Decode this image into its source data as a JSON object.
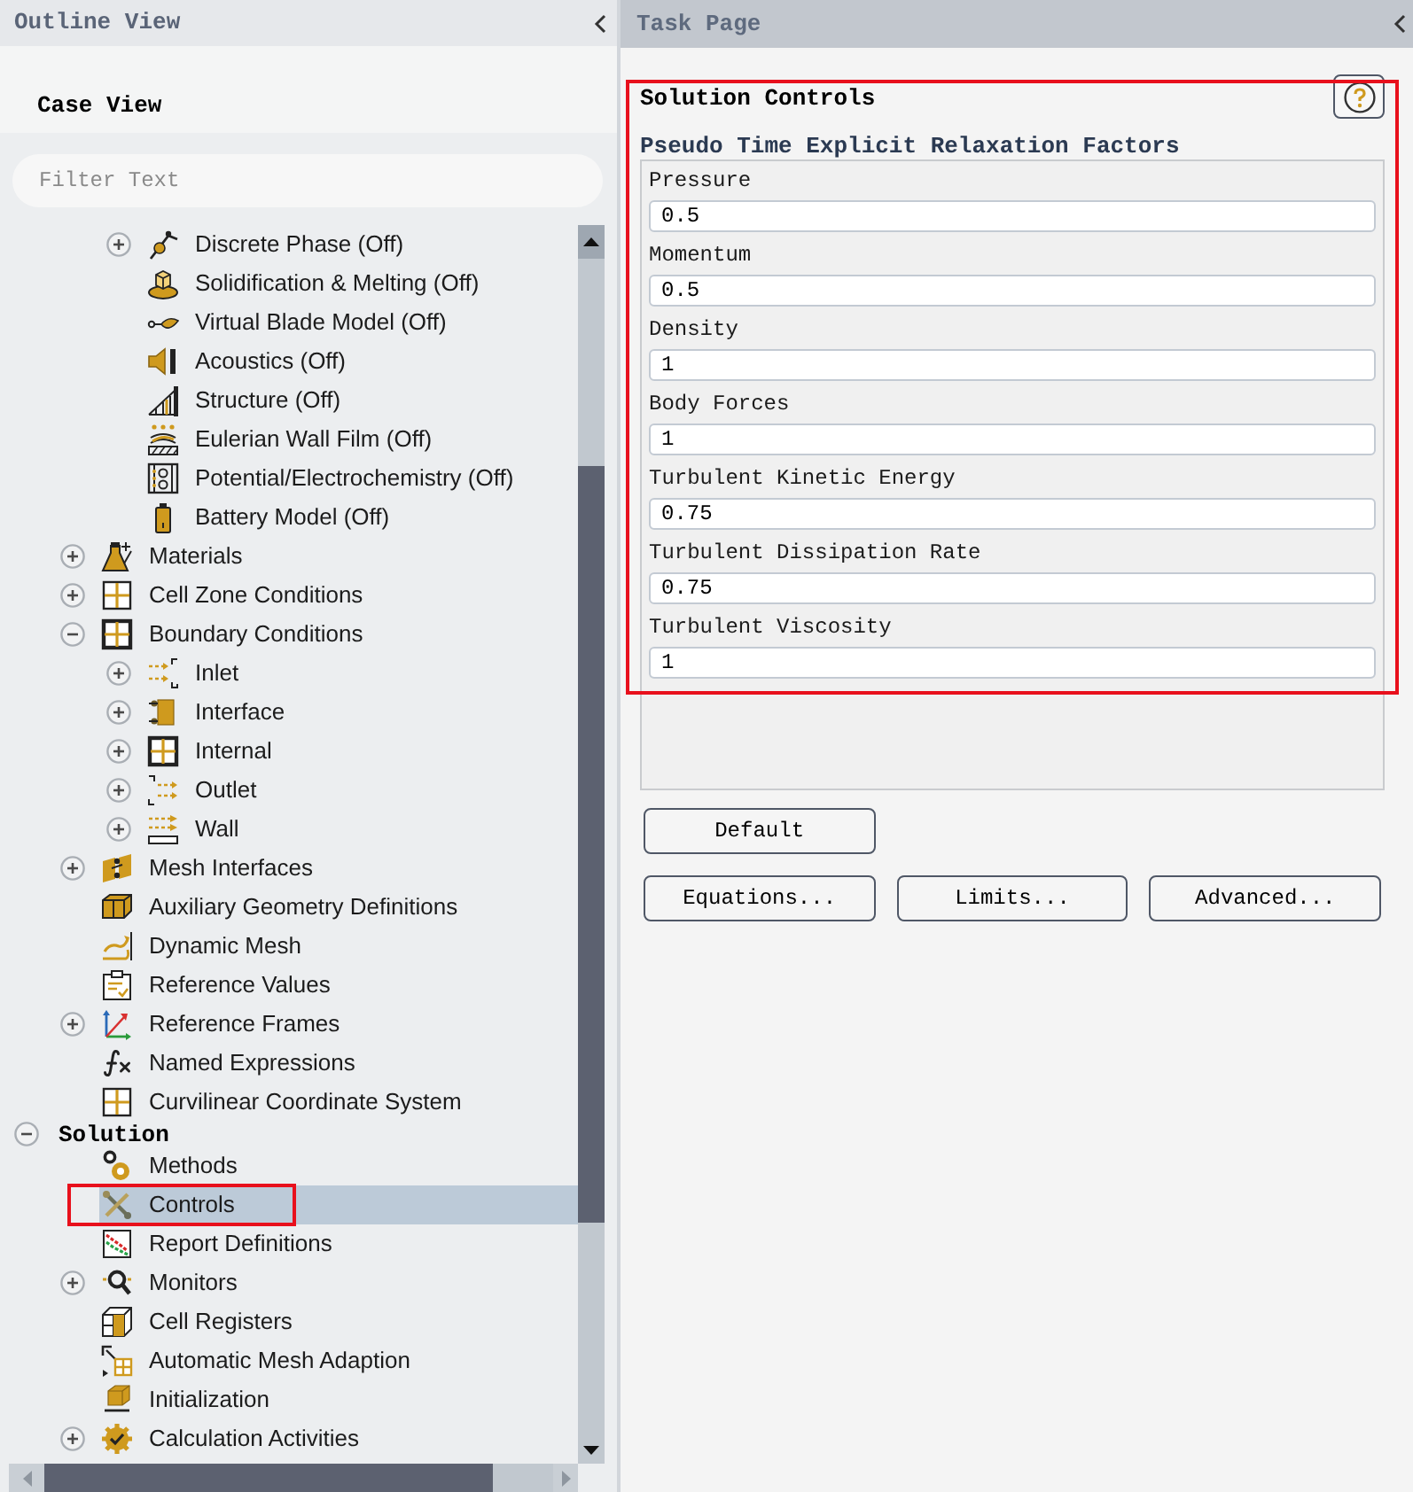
{
  "outline_view": {
    "title": "Outline View",
    "tab": "Case View",
    "filter": {
      "placeholder": "Filter Text"
    },
    "tree": [
      {
        "children": [
          {
            "children": [
              {
                "label": "Discrete Phase (Off)",
                "expanded": false,
                "selected": false,
                "highlighted": false
              },
              {
                "label": "Solidification & Melting (Off)",
                "selected": false,
                "highlighted": false
              },
              {
                "label": "Virtual Blade Model (Off)",
                "selected": false,
                "highlighted": false
              },
              {
                "label": "Acoustics (Off)",
                "selected": false,
                "highlighted": false
              },
              {
                "label": "Structure (Off)",
                "selected": false,
                "highlighted": false
              },
              {
                "label": "Eulerian Wall Film (Off)",
                "selected": false,
                "highlighted": false
              },
              {
                "label": "Potential/Electrochemistry (Off)",
                "selected": false,
                "highlighted": false
              },
              {
                "label": "Battery Model (Off)",
                "selected": false,
                "highlighted": false
              }
            ]
          },
          {
            "label": "Materials",
            "expanded": false,
            "selected": false,
            "highlighted": false
          },
          {
            "label": "Cell Zone Conditions",
            "expanded": false,
            "selected": false,
            "highlighted": false
          },
          {
            "label": "Boundary Conditions",
            "expanded": true,
            "selected": false,
            "highlighted": false,
            "children": [
              {
                "label": "Inlet",
                "expanded": false,
                "selected": false,
                "highlighted": false
              },
              {
                "label": "Interface",
                "expanded": false,
                "selected": false,
                "highlighted": false
              },
              {
                "label": "Internal",
                "expanded": false,
                "selected": false,
                "highlighted": false
              },
              {
                "label": "Outlet",
                "expanded": false,
                "selected": false,
                "highlighted": false
              },
              {
                "label": "Wall",
                "expanded": false,
                "selected": false,
                "highlighted": false
              }
            ]
          },
          {
            "label": "Mesh Interfaces",
            "expanded": false,
            "selected": false,
            "highlighted": false
          },
          {
            "label": "Auxiliary Geometry Definitions",
            "selected": false,
            "highlighted": false
          },
          {
            "label": "Dynamic Mesh",
            "selected": false,
            "highlighted": false
          },
          {
            "label": "Reference Values",
            "selected": false,
            "highlighted": false
          },
          {
            "label": "Reference Frames",
            "expanded": false,
            "selected": false,
            "highlighted": false
          },
          {
            "label": "Named Expressions",
            "selected": false,
            "highlighted": false
          },
          {
            "label": "Curvilinear Coordinate System",
            "selected": false,
            "highlighted": false
          }
        ]
      },
      {
        "label": "Solution",
        "expanded": true,
        "selected": false,
        "highlighted": false,
        "children": [
          {
            "label": "Methods",
            "selected": false,
            "highlighted": false
          },
          {
            "label": "Controls",
            "selected": true,
            "highlighted": true
          },
          {
            "label": "Report Definitions",
            "selected": false,
            "highlighted": false
          },
          {
            "label": "Monitors",
            "expanded": false,
            "selected": false,
            "highlighted": false
          },
          {
            "label": "Cell Registers",
            "selected": false,
            "highlighted": false
          },
          {
            "label": "Automatic Mesh Adaption",
            "selected": false,
            "highlighted": false
          },
          {
            "label": "Initialization",
            "selected": false,
            "highlighted": false
          },
          {
            "label": "Calculation Activities",
            "expanded": false,
            "selected": false,
            "highlighted": false
          }
        ]
      }
    ]
  },
  "task_page": {
    "title": "Task Page",
    "panel": {
      "title": "Solution Controls",
      "highlighted": true,
      "group": {
        "title": "Pseudo Time Explicit Relaxation Factors",
        "fields": [
          {
            "label": "Pressure",
            "value": "0.5"
          },
          {
            "label": "Momentum",
            "value": "0.5"
          },
          {
            "label": "Density",
            "value": "1"
          },
          {
            "label": "Body Forces",
            "value": "1"
          },
          {
            "label": "Turbulent Kinetic Energy",
            "value": "0.75"
          },
          {
            "label": "Turbulent Dissipation Rate",
            "value": "0.75"
          },
          {
            "label": "Turbulent Viscosity",
            "value": "1"
          }
        ]
      },
      "button_rows": [
        [
          "Default"
        ],
        [
          "Equations...",
          "Limits...",
          "Advanced..."
        ]
      ]
    }
  }
}
